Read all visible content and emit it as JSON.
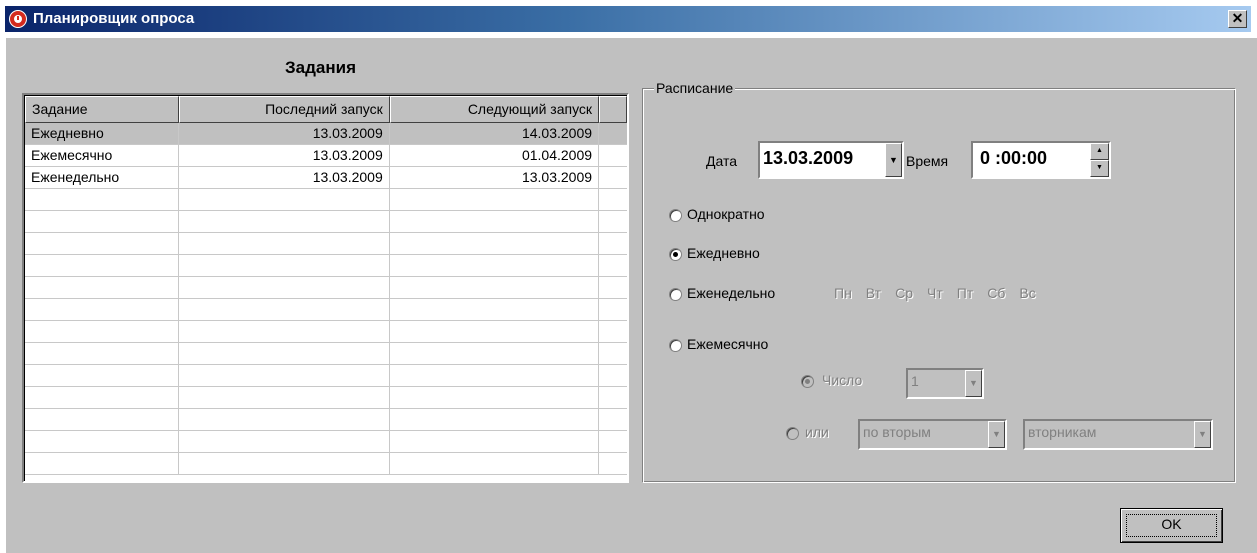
{
  "window": {
    "title": "Планировщик опроса",
    "close_label": "✕"
  },
  "tasks": {
    "heading": "Задания",
    "columns": [
      "Задание",
      "Последний запуск",
      "Следующий запуск"
    ],
    "rows": [
      {
        "name": "Ежедневно",
        "last": "13.03.2009",
        "next": "14.03.2009"
      },
      {
        "name": "Ежемесячно",
        "last": "13.03.2009",
        "next": "01.04.2009"
      },
      {
        "name": "Еженедельно",
        "last": "13.03.2009",
        "next": "13.03.2009"
      }
    ]
  },
  "schedule": {
    "legend": "Расписание",
    "date_label": "Дата",
    "date_value": "13.03.2009",
    "time_label": "Время",
    "time_value": "0 :00:00",
    "options": {
      "once": "Однократно",
      "daily": "Ежедневно",
      "weekly": "Еженедельно",
      "monthly": "Ежемесячно"
    },
    "selected": "daily",
    "weekdays": [
      "Пн",
      "Вт",
      "Ср",
      "Чт",
      "Пт",
      "Сб",
      "Вс"
    ],
    "monthly": {
      "day_label": "Число",
      "day_value": "1",
      "or_label": "или",
      "ordinal_value": "по вторым",
      "weekday_value": "вторникам"
    }
  },
  "buttons": {
    "ok": "OK"
  }
}
